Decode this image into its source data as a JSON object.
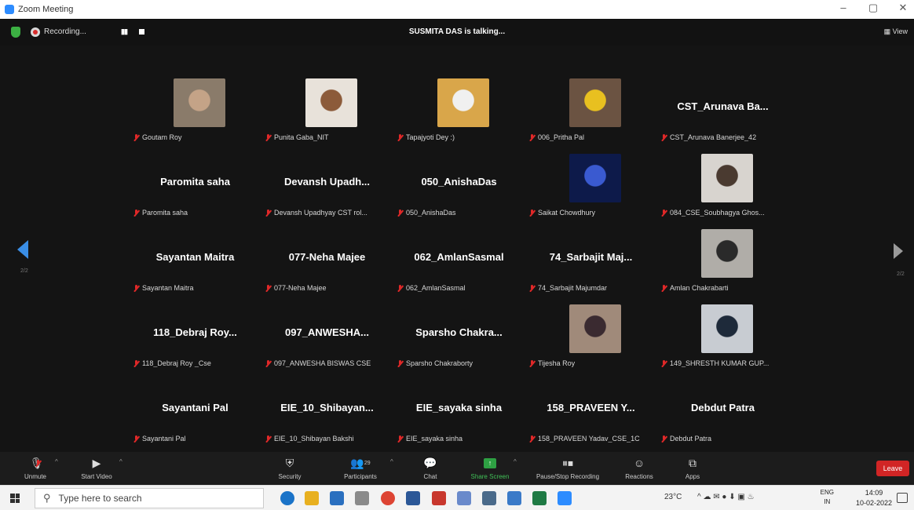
{
  "window": {
    "title": "Zoom Meeting",
    "controls": [
      "–",
      "▢",
      "✕"
    ]
  },
  "topbar": {
    "recording_label": "Recording...",
    "talking": "SUSMITA DAS is talking...",
    "view_label": "View"
  },
  "pager": {
    "left": "2/2",
    "right": "2/2"
  },
  "tiles": [
    {
      "big": "",
      "label": "Goutam Roy",
      "photo": true,
      "bg": "#8a7b6a",
      "fg": "#c4a387"
    },
    {
      "big": "",
      "label": "Punita Gaba_NIT",
      "photo": true,
      "bg": "#e8e2da",
      "fg": "#8c5b3a"
    },
    {
      "big": "",
      "label": "Tapajyoti Dey :)",
      "photo": true,
      "bg": "#d9a64a",
      "fg": "#f0f0f0"
    },
    {
      "big": "",
      "label": "006_Pritha Pal",
      "photo": true,
      "bg": "#6b5342",
      "fg": "#e8c020"
    },
    {
      "big": "CST_Arunava Ba...",
      "label": "CST_Arunava Banerjee_42",
      "photo": false
    },
    {
      "big": "Paromita saha",
      "label": "Paromita saha",
      "photo": false
    },
    {
      "big": "Devansh Upadh...",
      "label": "Devansh Upadhyay CST rol...",
      "photo": false
    },
    {
      "big": "050_AnishaDas",
      "label": "050_AnishaDas",
      "photo": false
    },
    {
      "big": "",
      "label": "Saikat Chowdhury",
      "photo": true,
      "bg": "#0d1a4a",
      "fg": "#3a5ad0"
    },
    {
      "big": "",
      "label": "084_CSE_Soubhagya Ghos...",
      "photo": true,
      "bg": "#d8d4cf",
      "fg": "#4a3a30"
    },
    {
      "big": "Sayantan Maitra",
      "label": "Sayantan Maitra",
      "photo": false
    },
    {
      "big": "077-Neha Majee",
      "label": "077-Neha Majee",
      "photo": false
    },
    {
      "big": "062_AmlanSasmal",
      "label": "062_AmlanSasmal",
      "photo": false
    },
    {
      "big": "74_Sarbajit Maj...",
      "label": "74_Sarbajit Majumdar",
      "photo": false
    },
    {
      "big": "",
      "label": "Amlan Chakrabarti",
      "photo": true,
      "bg": "#b0ada8",
      "fg": "#2a2a2a"
    },
    {
      "big": "118_Debraj Roy...",
      "label": "118_Debraj Roy _Cse",
      "photo": false
    },
    {
      "big": "097_ANWESHA...",
      "label": "097_ANWESHA BISWAS CSE",
      "photo": false
    },
    {
      "big": "Sparsho Chakra...",
      "label": "Sparsho Chakraborty",
      "photo": false
    },
    {
      "big": "",
      "label": "Tijesha Roy",
      "photo": true,
      "bg": "#a08a7a",
      "fg": "#3a2a30"
    },
    {
      "big": "",
      "label": "149_SHRESTH KUMAR GUP...",
      "photo": true,
      "bg": "#c8ccd2",
      "fg": "#1e2a3a"
    },
    {
      "big": "Sayantani Pal",
      "label": "Sayantani Pal",
      "photo": false
    },
    {
      "big": "EIE_10_Shibayan...",
      "label": "EIE_10_Shibayan Bakshi",
      "photo": false
    },
    {
      "big": "EIE_sayaka sinha",
      "label": "EIE_sayaka sinha",
      "photo": false
    },
    {
      "big": "158_PRAVEEN Y...",
      "label": "158_PRAVEEN Yadav_CSE_1C",
      "photo": false
    },
    {
      "big": "Debdut Patra",
      "label": "Debdut Patra",
      "photo": false
    }
  ],
  "toolbar": {
    "unmute": "Unmute",
    "start_video": "Start Video",
    "security": "Security",
    "participants": "Participants",
    "participants_count": "29",
    "chat": "Chat",
    "share_screen": "Share Screen",
    "recording": "Pause/Stop Recording",
    "reactions": "Reactions",
    "apps": "Apps",
    "leave": "Leave"
  },
  "taskbar": {
    "search_placeholder": "Type here to search",
    "temperature": "23°C",
    "lang_top": "ENG",
    "lang_bottom": "IN",
    "time": "14:09",
    "date": "10-02-2022"
  }
}
